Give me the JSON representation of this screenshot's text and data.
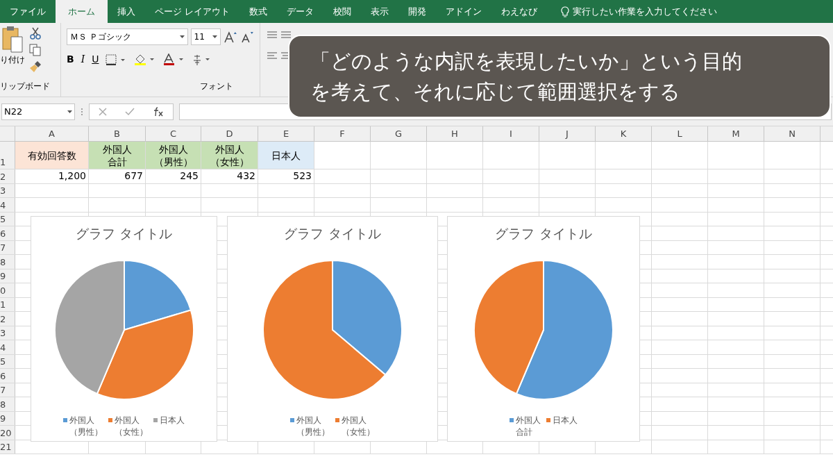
{
  "ribbon_tabs": [
    {
      "label": "ファイル",
      "selected": false
    },
    {
      "label": "ホーム",
      "selected": true
    },
    {
      "label": "挿入",
      "selected": false
    },
    {
      "label": "ページ レイアウト",
      "selected": false
    },
    {
      "label": "数式",
      "selected": false
    },
    {
      "label": "データ",
      "selected": false
    },
    {
      "label": "校閲",
      "selected": false
    },
    {
      "label": "表示",
      "selected": false
    },
    {
      "label": "開発",
      "selected": false
    },
    {
      "label": "アドイン",
      "selected": false
    },
    {
      "label": "わえなび",
      "selected": false
    }
  ],
  "tell_me": "実行したい作業を入力してください",
  "clipboard": {
    "paste": "り付け",
    "label": "リップボード"
  },
  "font_group": {
    "font_name": "ＭＳ Ｐゴシック",
    "font_size": "11",
    "bold": "B",
    "italic": "I",
    "underline": "U",
    "label": "フォント"
  },
  "name_box": "N22",
  "columns": [
    "A",
    "B",
    "C",
    "D",
    "E",
    "F",
    "G",
    "H",
    "I",
    "J",
    "K",
    "L",
    "M",
    "N"
  ],
  "row_labels": [
    "1",
    "2",
    "3",
    "4",
    "5",
    "6",
    "7",
    "8",
    "9",
    "0",
    "1",
    "2",
    "3",
    "4",
    "5",
    "6",
    "7",
    "8",
    "9",
    "20",
    "21"
  ],
  "cells": [
    [
      {
        "text": "有効回答数",
        "color": "#fce4d6"
      },
      {
        "text": "外国人合計",
        "color": "#c6e0b4"
      },
      {
        "text": "外国人（男性）",
        "color": "#c6e0b4"
      },
      {
        "text": "外国人（女性）",
        "color": "#c6e0b4"
      },
      {
        "text": "日本人",
        "color": "#ddebf7"
      }
    ],
    [
      {
        "text": "1,200"
      },
      {
        "text": "677"
      },
      {
        "text": "245"
      },
      {
        "text": "432"
      },
      {
        "text": "523"
      }
    ]
  ],
  "charts": [
    {
      "chart_data": {
        "type": "pie",
        "title": "グラフ タイトル",
        "categories": [
          "外国人（男性）",
          "外国人（女性）",
          "日本人"
        ],
        "series": [
          {
            "values": [
              20.4,
              36.0,
              43.6
            ]
          }
        ],
        "colors": [
          "#5b9bd5",
          "#ed7d31",
          "#a5a5a5"
        ]
      }
    },
    {
      "chart_data": {
        "type": "pie",
        "title": "グラフ タイトル",
        "categories": [
          "外国人（男性）",
          "外国人（女性）"
        ],
        "series": [
          {
            "values": [
              36.2,
              63.8
            ]
          }
        ],
        "colors": [
          "#5b9bd5",
          "#ed7d31"
        ]
      }
    },
    {
      "chart_data": {
        "type": "pie",
        "title": "グラフ タイトル",
        "categories": [
          "外国人合計",
          "日本人"
        ],
        "series": [
          {
            "values": [
              56.4,
              43.6
            ]
          }
        ],
        "colors": [
          "#5b9bd5",
          "#ed7d31"
        ]
      }
    }
  ],
  "caption": {
    "lines": [
      "「どのような内訳を表現したいか」という目的",
      "を考えて、それに応じて範囲選択をする"
    ]
  }
}
